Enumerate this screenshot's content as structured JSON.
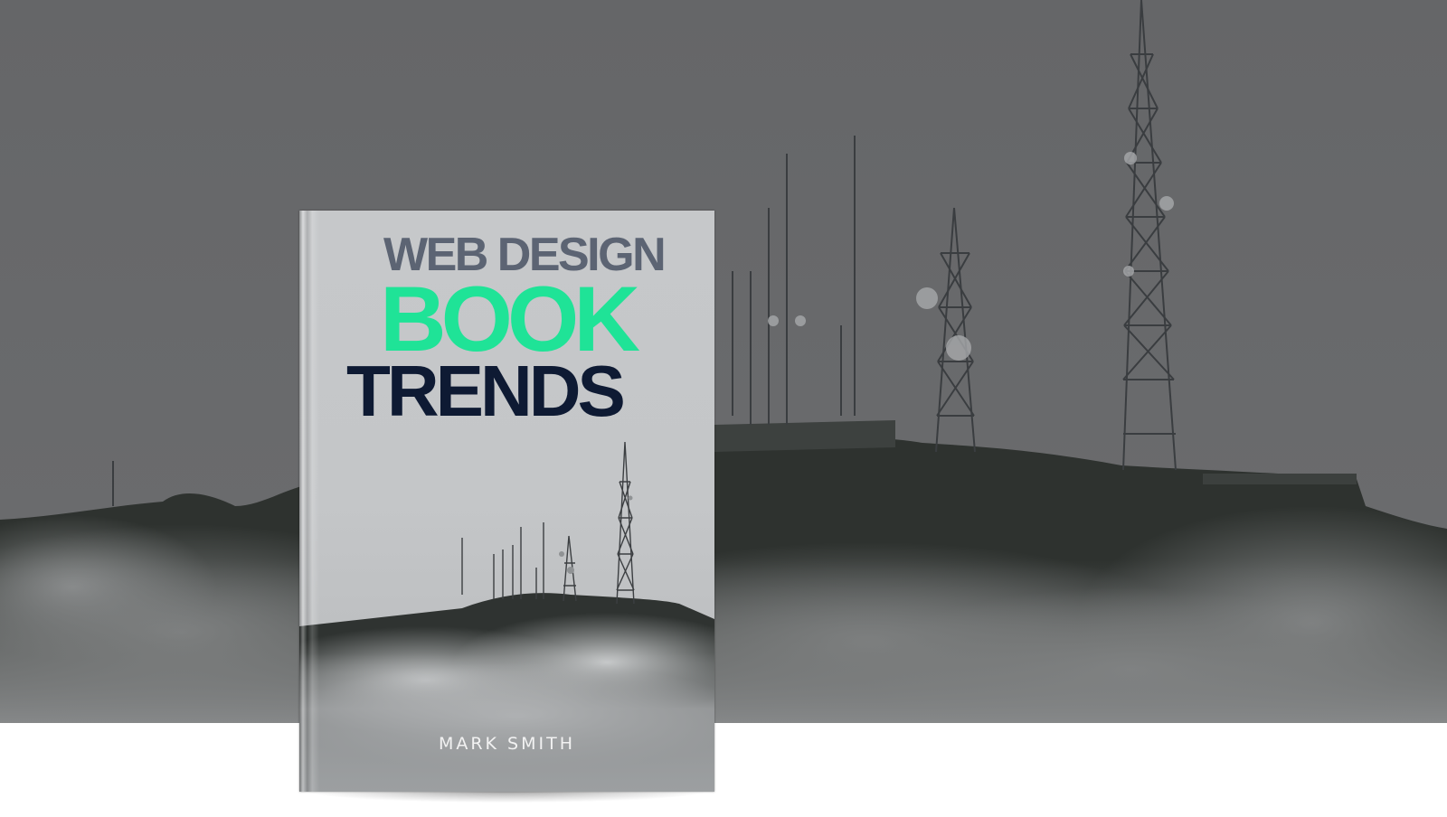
{
  "cover": {
    "title_line1": "WEB DESIGN",
    "title_line2": "BOOK",
    "title_line3": "TRENDS",
    "author": "MARK SMITH"
  },
  "colors": {
    "background_sky": "#67686a",
    "hill": "#2e322f",
    "title_line1": "#5c6473",
    "title_line2": "#1fe397",
    "title_line3": "#0e1a33",
    "author": "#f2f2f2",
    "page_bottom": "#ffffff"
  },
  "scene": {
    "subject": "radio-towers-on-misty-hill"
  }
}
